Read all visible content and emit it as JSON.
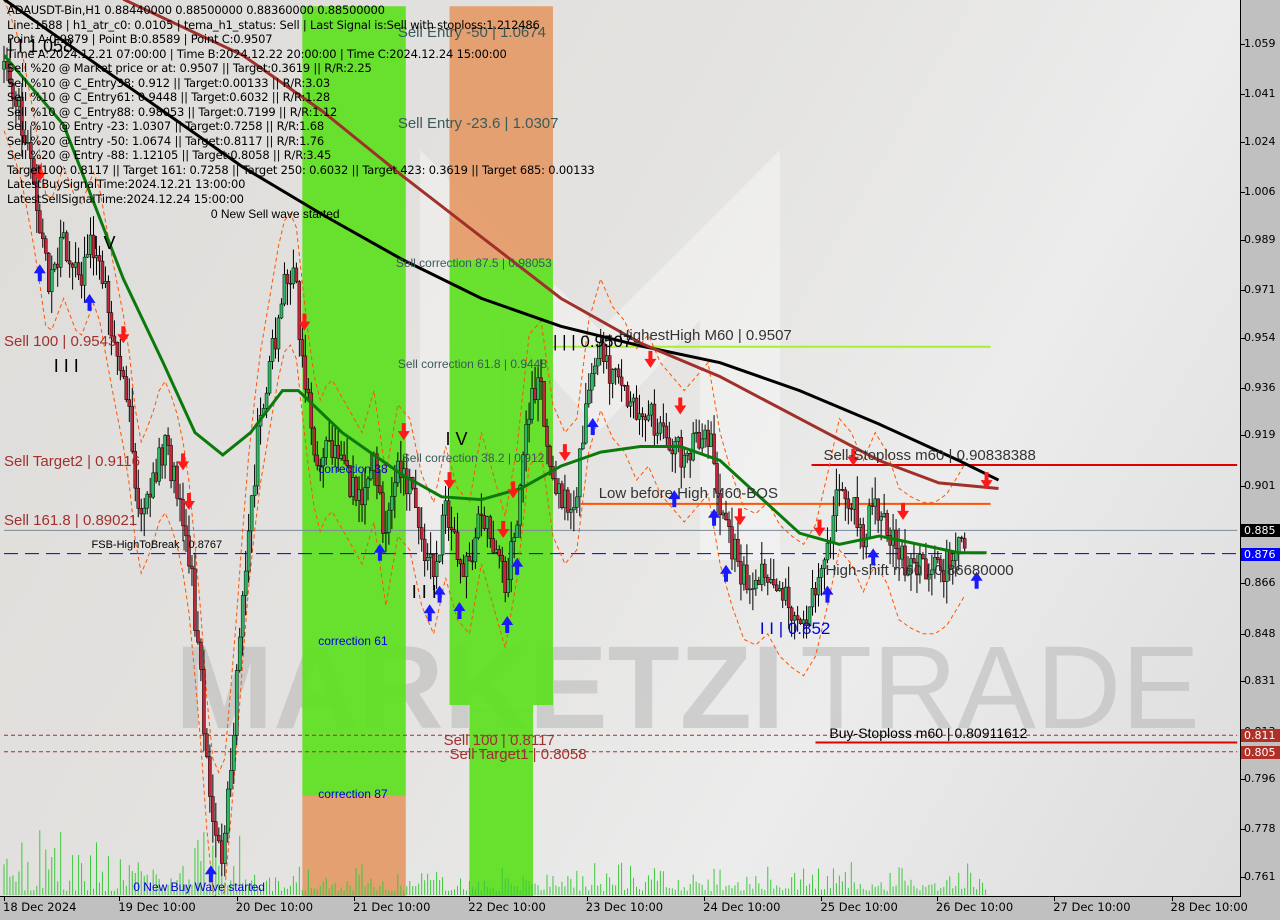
{
  "header": {
    "symbol_line": "ADAUSDT-Bin,H1  0.88440000 0.88500000 0.88360000 0.88500000",
    "lines": [
      "Line:1588 | h1_atr_c0: 0.0105 | tema_h1_status: Sell | Last Signal is:Sell with stoploss:1.212486",
      "Point A:0.9879 | Point B:0.8589 | Point C:0.9507",
      "Time A:2024.12.21 07:00:00 | Time B:2024.12.22 20:00:00 | Time C:2024.12.24 15:00:00",
      "Sell %20 @ Market price or at: 0.9507 || Target:0.3619 || R/R:2.25",
      "Sell %10 @ C_Entry38: 0.912 || Target:0.00133 || R/R:3.03",
      "Sell %10 @ C_Entry61: 0.9448 || Target:0.6032 || R/R:1.28",
      "Sell %10 @ C_Entry88: 0.98053 || Target:0.7199 || R/R:1.12",
      "Sell %10 @ Entry -23: 1.0307 || Target:0.7258 || R/R:1.68",
      "Sell %20 @ Entry -50: 1.0674 || Target:0.8117 || R/R:1.76",
      "Sell %20 @ Entry -88: 1.12105 || Target:0.8058 || R/R:3.45",
      "Target100: 0.8117 || Target 161: 0.7258 || Target 250: 0.6032 || Target 423: 0.3619 || Target 685: 0.00133",
      "LatestBuySignalTime:2024.12.21 13:00:00",
      "LatestSellSignalTime:2024.12.24 15:00:00"
    ]
  },
  "colors": {
    "green_zone": "#5ce01e",
    "orange_zone": "#e49a66",
    "bull_candle": "#2fb864",
    "bear_candle": "#c0283a",
    "ma_black": "#000000",
    "ma_brown": "#a0302a",
    "ma_green": "#0b7a0b",
    "blue_dash": "#0000e0",
    "stop_red": "#e00000",
    "level_orange": "#ff5500",
    "highest_high": "#a8f030",
    "volume": "#3cc83c",
    "watermark": "#b8b8b8"
  },
  "watermark": {
    "text_bold": "MARKETZI",
    "text_light": "TRADE"
  },
  "chart_data": {
    "type": "candlestick",
    "title": "ADAUSDT-Bin,H1",
    "xlabel": "",
    "ylabel": "",
    "ylim": [
      0.752,
      1.0725
    ],
    "grid": false,
    "x_ticks": [
      "18 Dec 2024",
      "19 Dec 10:00",
      "20 Dec 10:00",
      "21 Dec 10:00",
      "22 Dec 10:00",
      "23 Dec 10:00",
      "24 Dec 10:00",
      "25 Dec 10:00",
      "26 Dec 10:00",
      "27 Dec 10:00",
      "28 Dec 10:00"
    ],
    "x_tick_bar_index": [
      0,
      58,
      117,
      176,
      234,
      293,
      352,
      411,
      469,
      528,
      587
    ],
    "y_ticks": [
      "1.059",
      "1.041",
      "1.024",
      "1.006",
      "0.989",
      "0.971",
      "0.954",
      "0.936",
      "0.919",
      "0.901",
      "0.885",
      "0.876",
      "0.866",
      "0.848",
      "0.831",
      "0.813",
      "0.811",
      "0.805",
      "0.796",
      "0.778",
      "0.761"
    ],
    "y_tick_values": [
      1.059,
      1.041,
      1.024,
      1.006,
      0.989,
      0.971,
      0.954,
      0.936,
      0.919,
      0.901,
      0.866,
      0.848,
      0.831,
      0.813,
      0.796,
      0.778,
      0.761
    ],
    "price_badges": [
      {
        "label": "0.885",
        "value": 0.885,
        "color": "#000000"
      },
      {
        "label": "0.876",
        "value": 0.8767,
        "color": "#0000ff"
      },
      {
        "label": "0.811",
        "value": 0.8117,
        "color": "#b03028"
      },
      {
        "label": "0.805",
        "value": 0.8058,
        "color": "#b03028"
      }
    ],
    "bars_total": 600,
    "close_path": [
      [
        0,
        1.05
      ],
      [
        8,
        1.035
      ],
      [
        16,
        1.005
      ],
      [
        22,
        0.975
      ],
      [
        30,
        0.99
      ],
      [
        38,
        0.975
      ],
      [
        46,
        0.99
      ],
      [
        55,
        0.955
      ],
      [
        62,
        0.93
      ],
      [
        68,
        0.89
      ],
      [
        74,
        0.9
      ],
      [
        80,
        0.915
      ],
      [
        86,
        0.905
      ],
      [
        92,
        0.885
      ],
      [
        98,
        0.84
      ],
      [
        104,
        0.78
      ],
      [
        110,
        0.77
      ],
      [
        116,
        0.82
      ],
      [
        122,
        0.88
      ],
      [
        128,
        0.92
      ],
      [
        134,
        0.945
      ],
      [
        140,
        0.97
      ],
      [
        146,
        0.975
      ],
      [
        152,
        0.935
      ],
      [
        158,
        0.905
      ],
      [
        164,
        0.915
      ],
      [
        172,
        0.905
      ],
      [
        180,
        0.895
      ],
      [
        186,
        0.91
      ],
      [
        192,
        0.88
      ],
      [
        198,
        0.905
      ],
      [
        204,
        0.9
      ],
      [
        210,
        0.88
      ],
      [
        216,
        0.87
      ],
      [
        222,
        0.89
      ],
      [
        228,
        0.875
      ],
      [
        234,
        0.87
      ],
      [
        240,
        0.895
      ],
      [
        246,
        0.88
      ],
      [
        252,
        0.865
      ],
      [
        258,
        0.89
      ],
      [
        264,
        0.93
      ],
      [
        270,
        0.935
      ],
      [
        276,
        0.905
      ],
      [
        282,
        0.895
      ],
      [
        288,
        0.9
      ],
      [
        294,
        0.935
      ],
      [
        300,
        0.95
      ],
      [
        306,
        0.94
      ],
      [
        312,
        0.935
      ],
      [
        318,
        0.925
      ],
      [
        324,
        0.93
      ],
      [
        330,
        0.92
      ],
      [
        336,
        0.915
      ],
      [
        342,
        0.91
      ],
      [
        348,
        0.915
      ],
      [
        354,
        0.92
      ],
      [
        360,
        0.895
      ],
      [
        366,
        0.88
      ],
      [
        372,
        0.868
      ],
      [
        378,
        0.866
      ],
      [
        384,
        0.87
      ],
      [
        390,
        0.862
      ],
      [
        396,
        0.858
      ],
      [
        402,
        0.855
      ],
      [
        408,
        0.862
      ],
      [
        414,
        0.88
      ],
      [
        420,
        0.9
      ],
      [
        426,
        0.895
      ],
      [
        432,
        0.885
      ],
      [
        438,
        0.895
      ],
      [
        444,
        0.888
      ],
      [
        450,
        0.875
      ],
      [
        456,
        0.872
      ],
      [
        462,
        0.87
      ],
      [
        468,
        0.87
      ],
      [
        474,
        0.873
      ],
      [
        480,
        0.88
      ],
      [
        484,
        0.885
      ]
    ],
    "series": [
      {
        "name": "MA black (slow)",
        "color": "#000000",
        "points": [
          [
            0,
            1.075
          ],
          [
            40,
            1.055
          ],
          [
            80,
            1.035
          ],
          [
            120,
            1.015
          ],
          [
            160,
            0.998
          ],
          [
            200,
            0.982
          ],
          [
            240,
            0.968
          ],
          [
            280,
            0.958
          ],
          [
            320,
            0.951
          ],
          [
            360,
            0.945
          ],
          [
            400,
            0.935
          ],
          [
            440,
            0.923
          ],
          [
            480,
            0.91
          ],
          [
            500,
            0.903
          ]
        ]
      },
      {
        "name": "MA brown",
        "color": "#a0302a",
        "points": [
          [
            60,
            1.075
          ],
          [
            120,
            1.055
          ],
          [
            160,
            1.035
          ],
          [
            200,
            1.012
          ],
          [
            240,
            0.99
          ],
          [
            280,
            0.968
          ],
          [
            320,
            0.952
          ],
          [
            360,
            0.94
          ],
          [
            400,
            0.925
          ],
          [
            440,
            0.91
          ],
          [
            470,
            0.902
          ],
          [
            500,
            0.9
          ]
        ]
      },
      {
        "name": "MA green",
        "color": "#0b7a0b",
        "points": [
          [
            0,
            1.055
          ],
          [
            30,
            1.03
          ],
          [
            60,
            0.975
          ],
          [
            80,
            0.945
          ],
          [
            96,
            0.92
          ],
          [
            110,
            0.912
          ],
          [
            124,
            0.92
          ],
          [
            140,
            0.935
          ],
          [
            148,
            0.935
          ],
          [
            170,
            0.92
          ],
          [
            200,
            0.905
          ],
          [
            220,
            0.897
          ],
          [
            240,
            0.896
          ],
          [
            260,
            0.9
          ],
          [
            280,
            0.908
          ],
          [
            300,
            0.913
          ],
          [
            320,
            0.915
          ],
          [
            340,
            0.915
          ],
          [
            360,
            0.91
          ],
          [
            380,
            0.897
          ],
          [
            400,
            0.884
          ],
          [
            420,
            0.88
          ],
          [
            440,
            0.883
          ],
          [
            460,
            0.88
          ],
          [
            480,
            0.877
          ],
          [
            494,
            0.877
          ]
        ]
      }
    ],
    "zones": [
      {
        "name": "zone-green-1",
        "from_bar": 150,
        "to_bar": 202,
        "from": 1.0725,
        "to": 0.79,
        "color": "#5ce01e"
      },
      {
        "name": "zone-orange-1",
        "from_bar": 150,
        "to_bar": 202,
        "from": 0.79,
        "to": 0.752,
        "color": "#e49a66"
      },
      {
        "name": "zone-orange-2",
        "from_bar": 224,
        "to_bar": 276,
        "from": 1.0725,
        "to": 0.982,
        "color": "#e49a66"
      },
      {
        "name": "zone-green-2",
        "from_bar": 224,
        "to_bar": 276,
        "from": 0.982,
        "to": 0.8225,
        "color": "#5ce01e"
      },
      {
        "name": "zone-green-3",
        "from_bar": 234,
        "to_bar": 266,
        "from": 0.8225,
        "to": 0.752,
        "color": "#5ce01e"
      }
    ],
    "horizontal_lines": [
      {
        "name": "highest-high-line",
        "value": 0.9507,
        "from_bar": 276,
        "to_bar": 496,
        "color": "#a8f030",
        "style": "solid"
      },
      {
        "name": "sell-stoploss-line",
        "value": 0.90838388,
        "from_bar": 406,
        "to_bar": 620,
        "color": "#e00000",
        "style": "solid"
      },
      {
        "name": "low-before-high-line",
        "value": 0.8945,
        "from_bar": 290,
        "to_bar": 496,
        "color": "#ff5500",
        "style": "solid"
      },
      {
        "name": "current-price-line",
        "value": 0.885,
        "from_bar": 0,
        "to_bar": 620,
        "color": "#7d8a99",
        "style": "solid"
      },
      {
        "name": "fsb-blue-line",
        "value": 0.8767,
        "from_bar": 0,
        "to_bar": 620,
        "color": "#0000e0",
        "style": "dashed"
      },
      {
        "name": "sell-100-line",
        "value": 0.8117,
        "from_bar": 0,
        "to_bar": 620,
        "color": "#a03030",
        "style": "dotted"
      },
      {
        "name": "sell-target1-line",
        "value": 0.8058,
        "from_bar": 0,
        "to_bar": 620,
        "color": "#a03030",
        "style": "dotted"
      },
      {
        "name": "buy-stoploss-line",
        "value": 0.80911612,
        "from_bar": 408,
        "to_bar": 620,
        "color": "#e00000",
        "style": "solid"
      }
    ],
    "annotations": [
      {
        "text": "Sell Entry -50 | 1.0674",
        "bar": 198,
        "value": 1.063,
        "color": "#3a5a5a",
        "size": 15
      },
      {
        "text": "Sell Entry -23.6 | 1.0307",
        "bar": 198,
        "value": 1.0305,
        "color": "#3a5a5a",
        "size": 15
      },
      {
        "text": "0 New Sell wave started",
        "bar": 104,
        "value": 0.998,
        "color": "#000000",
        "size": 12
      },
      {
        "text": "Sell correction 87.5 | 0.98053",
        "bar": 197,
        "value": 0.9805,
        "color": "#3a5a5a",
        "size": 12
      },
      {
        "text": "Sell correction 61.8 | 0.9448",
        "bar": 198,
        "value": 0.9445,
        "color": "#3a5a5a",
        "size": 12
      },
      {
        "text": "Sell correction 38.2 | 0.912",
        "bar": 200,
        "value": 0.911,
        "color": "#3a5a5a",
        "size": 12
      },
      {
        "text": "correction 38",
        "bar": 158,
        "value": 0.907,
        "color": "#0000dd",
        "size": 12
      },
      {
        "text": "correction 61",
        "bar": 158,
        "value": 0.8455,
        "color": "#0000dd",
        "size": 12
      },
      {
        "text": "correction 87",
        "bar": 158,
        "value": 0.7905,
        "color": "#0000dd",
        "size": 12
      },
      {
        "text": "0 New Buy Wave started",
        "bar": 65,
        "value": 0.7575,
        "color": "#0000dd",
        "size": 12
      },
      {
        "text": "HighestHigh   M60 | 0.9507",
        "bar": 309,
        "value": 0.9545,
        "color": "#333333",
        "size": 15
      },
      {
        "text": "| | | 0.9507",
        "bar": 276,
        "value": 0.9523,
        "color": "#000000",
        "size": 17
      },
      {
        "text": "Low before High   M60-BOS",
        "bar": 299,
        "value": 0.898,
        "color": "#333333",
        "size": 15
      },
      {
        "text": "Sell-Stoploss m60 | 0.90838388",
        "bar": 412,
        "value": 0.9115,
        "color": "#333333",
        "size": 15
      },
      {
        "text": "High-shift m60 | 0.86680000",
        "bar": 413,
        "value": 0.8705,
        "color": "#333333",
        "size": 15
      },
      {
        "text": "I I | 0.852",
        "bar": 380,
        "value": 0.8495,
        "color": "#0000dd",
        "size": 17
      },
      {
        "text": "Buy-Stoploss m60 | 0.80911612",
        "bar": 415,
        "value": 0.8125,
        "color": "#000000",
        "size": 14
      },
      {
        "text": "Sell 100 | 0.8117",
        "bar": 221,
        "value": 0.8095,
        "color": "#a03030",
        "size": 15
      },
      {
        "text": "Sell Target1 | 0.8058",
        "bar": 224,
        "value": 0.8045,
        "color": "#a03030",
        "size": 15
      },
      {
        "text": "Sell 100 | 0.9543",
        "bar": 0,
        "value": 0.9525,
        "color": "#a03030",
        "size": 15
      },
      {
        "text": "Sell Target2 | 0.9116",
        "bar": 0,
        "value": 0.9095,
        "color": "#a03030",
        "size": 15
      },
      {
        "text": "Sell 161.8 | 0.89021",
        "bar": 0,
        "value": 0.8885,
        "color": "#a03030",
        "size": 15
      },
      {
        "text": "FSB-HighToBreak | 0.8767",
        "bar": 44,
        "value": 0.8795,
        "color": "#000000",
        "size": 11
      },
      {
        "text": "I I 1.058",
        "bar": 2,
        "value": 1.058,
        "color": "#000000",
        "size": 18
      },
      {
        "text": "I V",
        "bar": 45,
        "value": 0.9875,
        "color": "#000000",
        "size": 18
      },
      {
        "text": "I I I",
        "bar": 25,
        "value": 0.9435,
        "color": "#000000",
        "size": 18
      },
      {
        "text": "I V",
        "bar": 222,
        "value": 0.9175,
        "color": "#000000",
        "size": 18
      },
      {
        "text": "I I I",
        "bar": 205,
        "value": 0.8625,
        "color": "#000000",
        "size": 18
      }
    ],
    "sell_arrows_bars": [
      18,
      60,
      90,
      93,
      151,
      201,
      224,
      251,
      256,
      282,
      325,
      340,
      370,
      410,
      427,
      452,
      494
    ],
    "buy_arrows_bars": [
      18,
      43,
      104,
      189,
      214,
      219,
      229,
      253,
      258,
      296,
      337,
      357,
      363,
      414,
      437,
      489
    ],
    "volume_level": "low"
  }
}
